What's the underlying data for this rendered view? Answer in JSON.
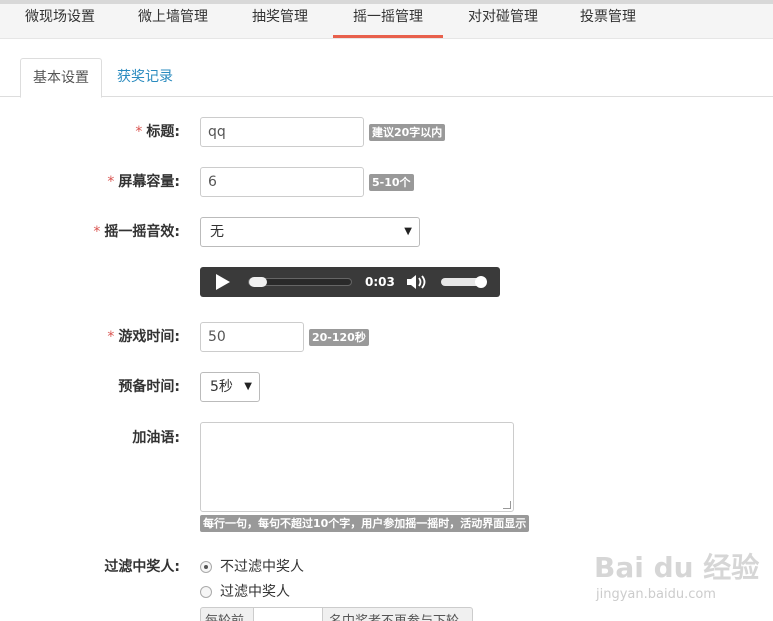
{
  "top_nav": {
    "tabs": [
      {
        "label": "微现场设置"
      },
      {
        "label": "微上墙管理"
      },
      {
        "label": "抽奖管理"
      },
      {
        "label": "摇一摇管理"
      },
      {
        "label": "对对碰管理"
      },
      {
        "label": "投票管理"
      }
    ],
    "active_index": 3,
    "accent_color": "#e8604c"
  },
  "sub_tabs": {
    "tabs": [
      {
        "label": "基本设置"
      },
      {
        "label": "获奖记录"
      }
    ],
    "active_index": 0
  },
  "form": {
    "title": {
      "label": "标题:",
      "required": "*",
      "value": "qq",
      "hint": "建议20字以内"
    },
    "screen_capacity": {
      "label": "屏幕容量:",
      "required": "*",
      "value": "6",
      "hint": "5-10个"
    },
    "shake_sound": {
      "label": "摇一摇音效:",
      "required": "*",
      "selected": "无"
    },
    "audio_player": {
      "time": "0:03",
      "progress": 0.0,
      "volume": 1.0
    },
    "game_time": {
      "label": "游戏时间:",
      "required": "*",
      "value": "50",
      "hint": "20-120秒"
    },
    "prep_time": {
      "label": "预备时间:",
      "selected": "5秒"
    },
    "cheer": {
      "label": "加油语:",
      "value": "",
      "hint": "每行一句，每句不超过10个字，用户参加摇一摇时，活动界面显示"
    },
    "filter_winner": {
      "label": "过滤中奖人:",
      "options": [
        {
          "label": "不过滤中奖人",
          "checked": true
        },
        {
          "label": "过滤中奖人",
          "checked": false
        }
      ],
      "rule_prefix": "每轮前",
      "rule_suffix": "名中奖者不再参与下轮"
    }
  },
  "watermark": {
    "logo": "Bai du 经验",
    "url": "jingyan.baidu.com"
  }
}
